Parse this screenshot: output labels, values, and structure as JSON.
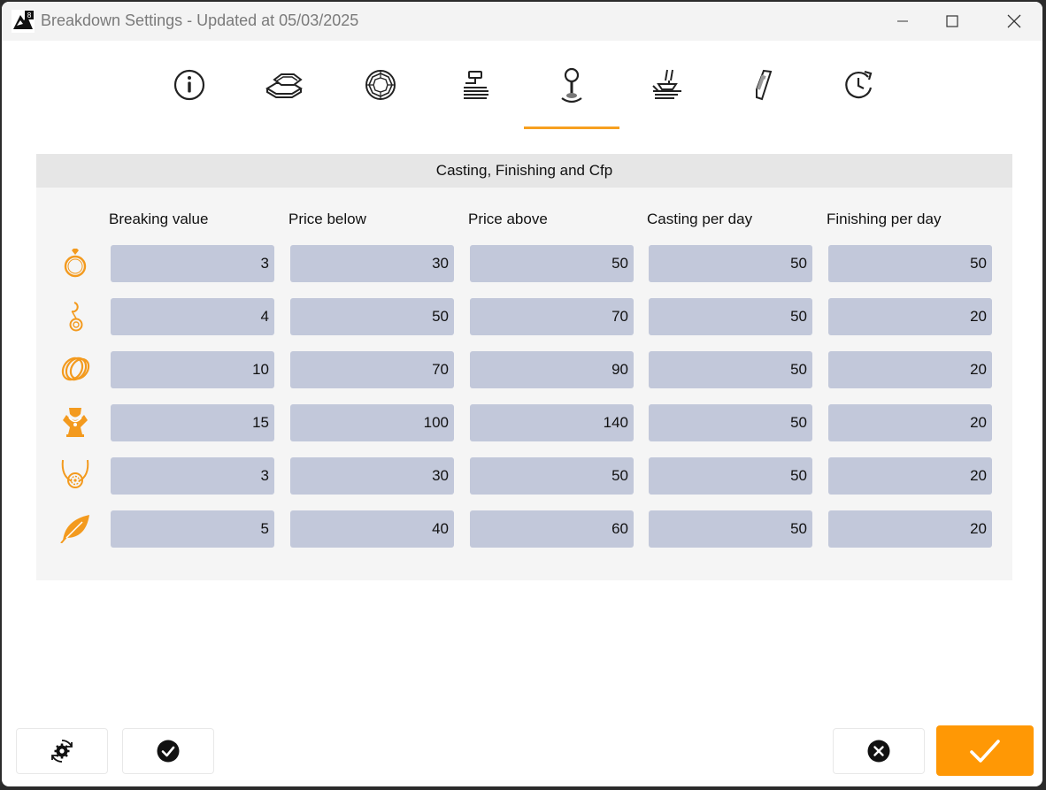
{
  "window": {
    "title": "Breakdown Settings - Updated at 05/03/2025"
  },
  "tabs": [
    {
      "icon": "info-icon"
    },
    {
      "icon": "gold-bars-icon"
    },
    {
      "icon": "diamond-icon"
    },
    {
      "icon": "wire-spool-icon"
    },
    {
      "icon": "casting-icon",
      "active": true
    },
    {
      "icon": "setting-tools-icon"
    },
    {
      "icon": "polish-tool-icon"
    },
    {
      "icon": "clock-refresh-icon"
    }
  ],
  "panel": {
    "title": "Casting, Finishing and Cfp",
    "columns": [
      "Breaking value",
      "Price below",
      "Price above",
      "Casting per day",
      "Finishing per day"
    ],
    "rows": [
      {
        "icon": "ring-icon",
        "values": [
          "3",
          "30",
          "50",
          "50",
          "50"
        ]
      },
      {
        "icon": "earring-icon",
        "values": [
          "4",
          "50",
          "70",
          "50",
          "20"
        ]
      },
      {
        "icon": "bangle-icon",
        "values": [
          "10",
          "70",
          "90",
          "50",
          "20"
        ]
      },
      {
        "icon": "necklace-bust-icon",
        "values": [
          "15",
          "100",
          "140",
          "50",
          "20"
        ]
      },
      {
        "icon": "pendant-necklace-icon",
        "values": [
          "3",
          "30",
          "50",
          "50",
          "20"
        ]
      },
      {
        "icon": "leaf-icon",
        "values": [
          "5",
          "40",
          "60",
          "50",
          "20"
        ]
      }
    ]
  },
  "colors": {
    "accent": "#f7a020",
    "ok_button": "#ff9805",
    "cell_bg": "#c2c8da"
  }
}
